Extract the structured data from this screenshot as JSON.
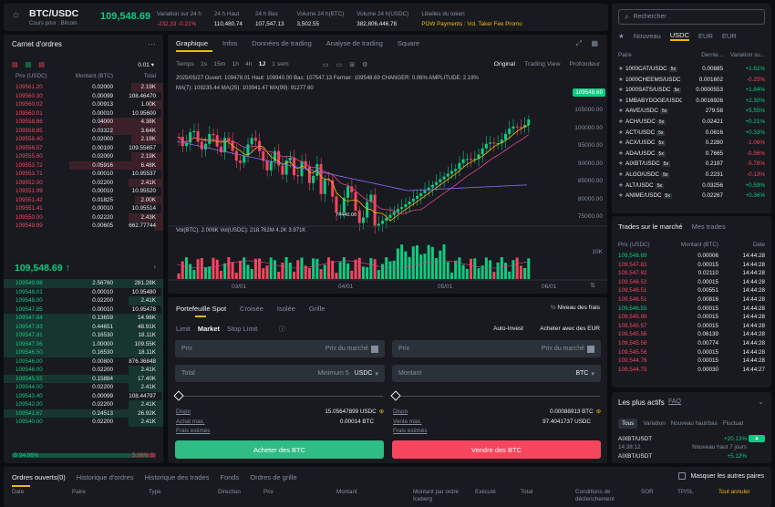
{
  "header": {
    "pair": "BTC/USDC",
    "subtitle": "Cours pour : Bitcoin",
    "price": "109,548.69",
    "stats": [
      {
        "label": "Variation sur 24 h",
        "value": "-232.33 -0.21%",
        "cls": "red"
      },
      {
        "label": "24 h Haut",
        "value": "110,480.74",
        "cls": ""
      },
      {
        "label": "24 h Bas",
        "value": "107,547.13",
        "cls": ""
      },
      {
        "label": "Volume 24 h(BTC)",
        "value": "3,502.55",
        "cls": ""
      },
      {
        "label": "Volume 24 h(USDC)",
        "value": "382,806,446.78",
        "cls": ""
      },
      {
        "label": "Libellés du token",
        "value": "POW  Payments : Vol.  Taker Fee Promo",
        "cls": "yellow"
      }
    ]
  },
  "orderbook": {
    "title": "Carnet d'ordres",
    "precision": "0.01",
    "cols": [
      "Prix (USDC)",
      "Montant (BTC)",
      "Total"
    ],
    "asks": [
      [
        "109561.20",
        "0.02000",
        "2.19K",
        20
      ],
      [
        "109560.30",
        "0.00099",
        "108.46470",
        1
      ],
      [
        "109560.02",
        "0.00913",
        "1.00K",
        9
      ],
      [
        "109560.01",
        "0.00010",
        "10.95600",
        1
      ],
      [
        "109558.86",
        "0.04000",
        "4.38K",
        40
      ],
      [
        "109558.85",
        "0.03322",
        "3.64K",
        33
      ],
      [
        "109558.40",
        "0.02000",
        "2.19K",
        20
      ],
      [
        "109556.57",
        "0.00100",
        "109.55657",
        1
      ],
      [
        "109555.60",
        "0.02000",
        "2.19K",
        20
      ],
      [
        "109553.72",
        "0.05916",
        "6.48K",
        59
      ],
      [
        "109553.71",
        "0.00010",
        "10.95537",
        1
      ],
      [
        "109552.00",
        "0.02200",
        "2.41K",
        22
      ],
      [
        "109551.99",
        "0.00010",
        "10.95520",
        1
      ],
      [
        "109551.42",
        "0.01825",
        "2.00K",
        18
      ],
      [
        "109551.41",
        "0.00010",
        "10.95514",
        1
      ],
      [
        "109550.00",
        "0.02220",
        "2.43K",
        22
      ],
      [
        "109549.99",
        "0.00605",
        "662.77744",
        6
      ]
    ],
    "mid": "109,548.69",
    "bids": [
      [
        "109549.98",
        "2.56760",
        "281.28K",
        100
      ],
      [
        "109548.01",
        "0.00010",
        "10.95480",
        1
      ],
      [
        "109548.00",
        "0.02200",
        "2.41K",
        22
      ],
      [
        "109547.85",
        "0.00010",
        "10.95478",
        1
      ],
      [
        "109547.84",
        "0.13659",
        "14.96K",
        100
      ],
      [
        "109547.83",
        "0.44651",
        "48.91K",
        100
      ],
      [
        "109547.81",
        "0.16530",
        "18.11K",
        100
      ],
      [
        "109547.06",
        "1.00000",
        "109.55K",
        100
      ],
      [
        "109546.50",
        "0.16530",
        "18.11K",
        100
      ],
      [
        "109546.00",
        "0.00800",
        "876.36848",
        8
      ],
      [
        "109546.00",
        "0.02200",
        "2.41K",
        22
      ],
      [
        "109545.55",
        "0.15884",
        "17.40K",
        100
      ],
      [
        "109544.00",
        "0.02200",
        "2.41K",
        22
      ],
      [
        "109543.40",
        "0.00099",
        "108.44797",
        1
      ],
      [
        "109542.00",
        "0.02200",
        "2.41K",
        22
      ],
      [
        "109541.67",
        "0.24513",
        "26.92K",
        100
      ],
      [
        "109540.00",
        "0.02200",
        "2.41K",
        22
      ]
    ],
    "buy_pct": "94.96%",
    "sell_pct": "5.06%"
  },
  "chart": {
    "tabs": [
      "Graphique",
      "Infos",
      "Données de trading",
      "Analyse de trading",
      "Square"
    ],
    "intervals": [
      "Temps",
      "1s",
      "15m",
      "1h",
      "4h",
      "1J",
      "1 sem"
    ],
    "views": [
      "Original",
      "Trading View",
      "Profondeur"
    ],
    "ohlc": "2025/05/27  Ouvert: 109478.01  Haut: 109940.00  Bas: 107547.13  Fermer: 109548.69  CHANGER: 0.06%  AMPLITUDE: 2.19%",
    "ma": "MA(7): 109235.44   MA(25): 103941.47   MA(99): 91277.60",
    "vol": "Vol(BTC): 2.006K   Vol(USDC): 218.762M   4.2K   3.971K",
    "yticks": [
      "105000.00",
      "100000.00",
      "95000.00",
      "90000.00",
      "85000.00",
      "80000.00",
      "75000.00"
    ],
    "current": "109548.69",
    "low_label": "74440.00",
    "vol_tick": "10K",
    "xticks": [
      "03/01",
      "04/01",
      "05/01",
      "06/01"
    ]
  },
  "trade": {
    "tabs": [
      "Portefeuille Spot",
      "Croisée",
      "Isolée",
      "Grille"
    ],
    "fees": "Niveau des frais",
    "types": [
      "Limit",
      "Market",
      "Stop Limit"
    ],
    "auto": "Auto-Invest",
    "buy_eur": "Acheter avec des EUR",
    "price_label": "Prix",
    "price_ph": "Prix du marché",
    "total_label": "Total",
    "min": "Minimum 5",
    "unit_usdc": "USDC",
    "amount_label": "Montant",
    "unit_btc": "BTC",
    "buy": {
      "dispo": "Dispo",
      "dispo_v": "15.05647899 USDC",
      "max": "Achat max.",
      "max_v": "0.00014 BTC",
      "fees": "Frais estimés",
      "btn": "Acheter des BTC"
    },
    "sell": {
      "dispo": "Dispo",
      "dispo_v": "0.00088913 BTC",
      "max": "Vente max.",
      "max_v": "97.4041737 USDC",
      "fees": "Frais estimés",
      "btn": "Vendre des BTC"
    }
  },
  "markets": {
    "search": "Rechercher",
    "tabs": [
      "Nouveau",
      "USDC",
      "EUR",
      "EUR"
    ],
    "cols": [
      "Paire",
      "Dernie...",
      "Variation su..."
    ],
    "rows": [
      [
        "1000CAT/USDC",
        "5x",
        "0.00885",
        "+1.61%"
      ],
      [
        "1000CHEEMS/USDC",
        "5x",
        "0.001602",
        "-0.25%"
      ],
      [
        "1000SATS/USDC",
        "5x",
        "0.0000553",
        "+1.84%"
      ],
      [
        "1MBABYDOGE/USDC",
        "5x",
        "0.0016926",
        "+2.30%"
      ],
      [
        "AAVE/USDC",
        "5x",
        "279.58",
        "+5.55%"
      ],
      [
        "ACH/USDC",
        "5x",
        "0.02421",
        "+0.21%"
      ],
      [
        "ACT/USDC",
        "5x",
        "0.0616",
        "+0.33%"
      ],
      [
        "ACX/USDC",
        "5x",
        "0.2280",
        "-1.06%"
      ],
      [
        "ADA/USDC",
        "5x",
        "0.7665",
        "-0.56%"
      ],
      [
        "AIXBT/USDC",
        "5x",
        "0.2197",
        "-5.78%"
      ],
      [
        "ALGO/USDC",
        "5x",
        "0.2231",
        "-0.13%"
      ],
      [
        "ALT/USDC",
        "5x",
        "0.03256",
        "+0.59%"
      ],
      [
        "ANIME/USDC",
        "5x",
        "0.02267",
        "+0.36%"
      ]
    ]
  },
  "trades": {
    "tabs": [
      "Trades sur le marché",
      "Mes trades"
    ],
    "cols": [
      "Prix (USDC)",
      "Montant (BTC)",
      "Date"
    ],
    "rows": [
      [
        "109,548.69",
        "0.00006",
        "14:44:28",
        "g"
      ],
      [
        "109,547.83",
        "0.00015",
        "14:44:28",
        "r"
      ],
      [
        "109,547.82",
        "0.02110",
        "14:44:28",
        "r"
      ],
      [
        "109,546.52",
        "0.00015",
        "14:44:28",
        "r"
      ],
      [
        "109,546.51",
        "0.00551",
        "14:44:28",
        "r"
      ],
      [
        "109,546.51",
        "0.00816",
        "14:44:28",
        "r"
      ],
      [
        "109,546.55",
        "0.00015",
        "14:44:28",
        "g"
      ],
      [
        "109,545.99",
        "0.00015",
        "14:44:28",
        "r"
      ],
      [
        "109,545.57",
        "0.00015",
        "14:44:28",
        "r"
      ],
      [
        "109,545.56",
        "0.06139",
        "14:44:28",
        "r"
      ],
      [
        "109,545.56",
        "0.00774",
        "14:44:28",
        "r"
      ],
      [
        "109,545.56",
        "0.00015",
        "14:44:28",
        "r"
      ],
      [
        "109,544.76",
        "0.00015",
        "14:44:28",
        "r"
      ],
      [
        "109,544.75",
        "0.00030",
        "14:44:27",
        "r"
      ]
    ]
  },
  "movers": {
    "title": "Les plus actifs",
    "faq": "FAQ",
    "tabs": [
      "Tous",
      "Variation",
      "Nouveau haut/bas",
      "Fluctuat"
    ],
    "rows": [
      [
        "AIXBT/USDT",
        "14:38:12",
        "+20.13%",
        "Nouveau haut 7 jours"
      ],
      [
        "AIXBT/USDT",
        "",
        "+5.12%",
        ""
      ]
    ]
  },
  "bottom": {
    "tabs": [
      "Ordres ouverts(0)",
      "Historique d'ordres",
      "Historique des trades",
      "Fonds",
      "Ordres de grille"
    ],
    "hide": "Masquer les autres paires",
    "cols": [
      "Date",
      "Paire",
      "Type",
      "Direction",
      "Prix",
      "Montant",
      "Montant par ordre Iceberg",
      "Exécuté",
      "Total",
      "Conditions de déclenchement",
      "SOR",
      "TP/SL",
      "Tout annuler"
    ]
  }
}
